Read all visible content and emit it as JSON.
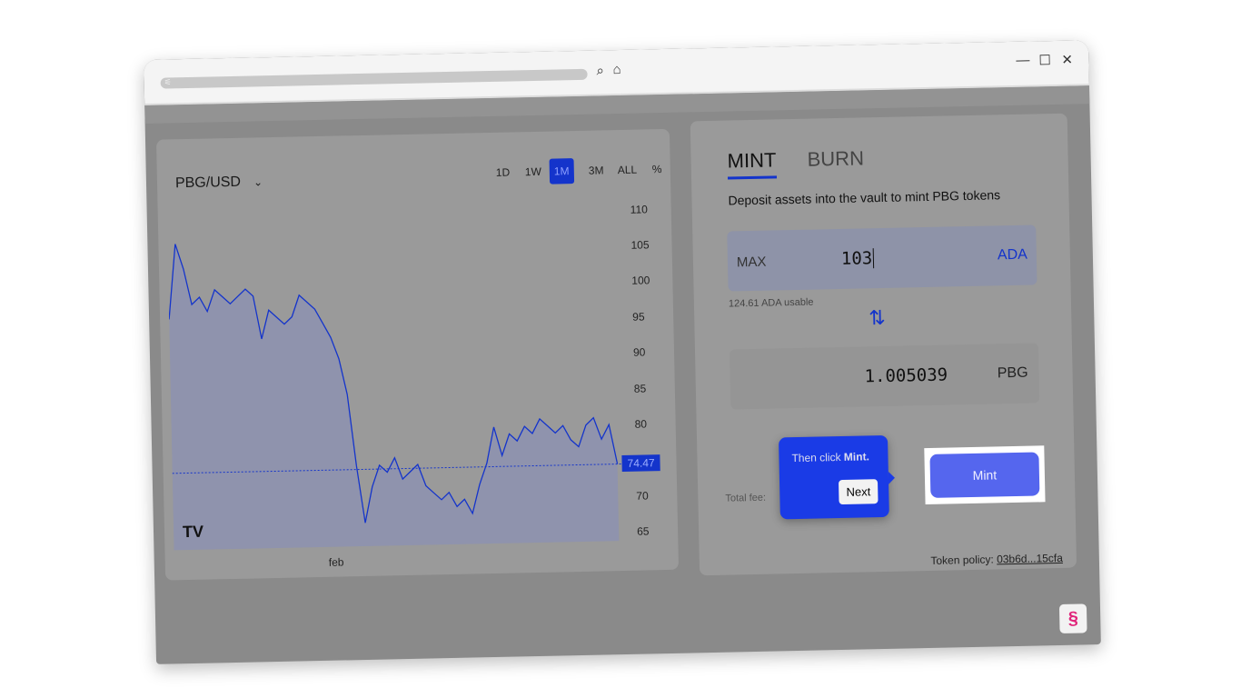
{
  "browser": {
    "url_icon": "sliders-icon",
    "search_icon": "search-icon",
    "home_icon": "home-icon",
    "minimize": "—",
    "maximize": "☐",
    "close": "✕"
  },
  "chart": {
    "pair": "PBG/USD",
    "ranges": [
      "1D",
      "1W",
      "1M",
      "3M",
      "ALL",
      "%"
    ],
    "active_range": "1M",
    "last_price": "74.47",
    "logo": "TV"
  },
  "chart_data": {
    "type": "area",
    "xlabel": "",
    "ylabel": "",
    "x_tick_labels": [
      "feb"
    ],
    "y_ticks": [
      110,
      105,
      100,
      95,
      90,
      85,
      80,
      75,
      70,
      65
    ],
    "ylim": [
      65,
      112
    ],
    "last_value": 74.47,
    "values": [
      96,
      106.5,
      103,
      98,
      99,
      97,
      100,
      99,
      98,
      99,
      100,
      99,
      93,
      97,
      96,
      95,
      96,
      99,
      98,
      97,
      95,
      93,
      90,
      85,
      75,
      67,
      72,
      75,
      74,
      76,
      73,
      74,
      75,
      72,
      71,
      70,
      71,
      69,
      70,
      68,
      72,
      75,
      80,
      76,
      79,
      78,
      80,
      79,
      81,
      80,
      79,
      80,
      78,
      77,
      80,
      81,
      78,
      80,
      74.5
    ],
    "accent": "#1434cb"
  },
  "mint": {
    "tabs": [
      "MINT",
      "BURN"
    ],
    "active_tab": "MINT",
    "description": "Deposit assets into the vault to mint PBG tokens",
    "max_label": "MAX",
    "input_value": "103",
    "input_unit": "ADA",
    "usable": "124.61 ADA usable",
    "output_value": "1.005039",
    "output_unit": "PBG",
    "total_fee_label": "Total fee:",
    "mint_button": "Mint",
    "token_policy_label": "Token policy:",
    "token_policy_value": "03b6d...15cfa"
  },
  "tooltip": {
    "text_prefix": "Then click ",
    "text_bold": "Mint.",
    "next_button": "Next"
  }
}
